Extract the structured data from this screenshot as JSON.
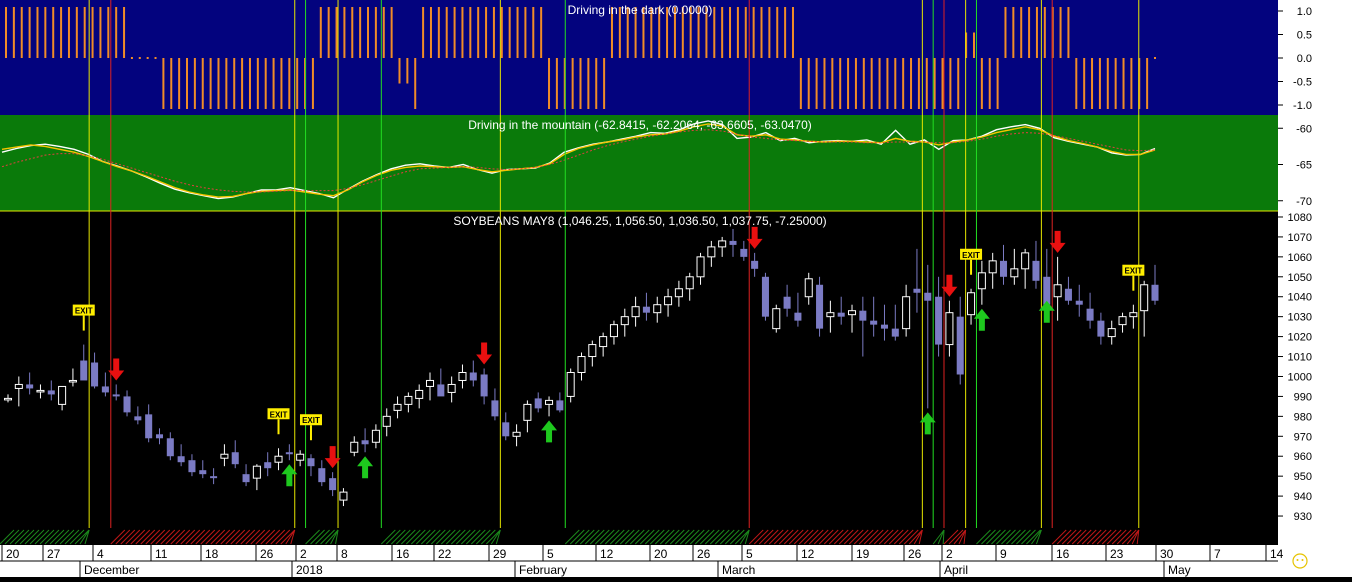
{
  "colors": {
    "panel1_bg": "#03037e",
    "panel2_bg": "#0a7a0a",
    "panel3_bg": "#000000",
    "axis_bg": "#ffffff",
    "bar_orange": "#f08c28",
    "fast_line": "#ffffff",
    "slow_line": "#f5c400",
    "trend_line": "#e04040",
    "candle_up": "#ffffff",
    "candle_down": "#7b7bc4",
    "buy_arrow": "#1ec81e",
    "sell_arrow": "#e81010",
    "exit_flag": "#ffee00",
    "vline_green": "#22dd22",
    "vline_red": "#dd2222",
    "vline_yellow": "#e6e600"
  },
  "chart_data": [
    {
      "type": "bar",
      "title": "Driving in the dark (0.0000)",
      "ylim": [
        -1.2,
        1.2
      ],
      "yticks": [
        "1.0",
        "0.5",
        "0.0",
        "-0.5",
        "-1.0"
      ],
      "ytick_values": [
        1.0,
        0.5,
        0.0,
        -0.5,
        -1.0
      ],
      "values": [
        1,
        1,
        1,
        1,
        1,
        1,
        1,
        1,
        1,
        1,
        1,
        1,
        1,
        1,
        1,
        1,
        0,
        0,
        0,
        0,
        -1,
        -1,
        -1,
        -1,
        -1,
        -1,
        -1,
        -1,
        -1,
        -1,
        -1,
        -1,
        -1,
        -1,
        -1,
        -1,
        -1,
        -1,
        -1,
        -1,
        1,
        1,
        1,
        1,
        1,
        1,
        1,
        1,
        1,
        1,
        -0.5,
        -0.5,
        -1,
        1,
        1,
        1,
        1,
        1,
        1,
        1,
        1,
        1,
        1,
        1,
        1,
        1,
        1,
        1,
        1,
        -1,
        -1,
        -1,
        -1,
        -1,
        -1,
        -1,
        -1,
        1,
        1,
        1,
        1,
        1,
        1,
        1,
        1,
        1,
        1,
        1,
        1,
        1,
        1,
        1,
        1,
        1,
        1,
        1,
        1,
        1,
        1,
        1,
        1,
        -1,
        -1,
        -1,
        -1,
        -1,
        -1,
        -1,
        -1,
        -1,
        -1,
        -1,
        -1,
        -1,
        -1,
        -1,
        -1,
        -1,
        -1,
        -1,
        -1,
        -1,
        0.5,
        0.5,
        -1,
        -1,
        -1,
        1,
        1,
        1,
        1,
        1,
        1,
        1,
        1,
        1,
        -1,
        -1,
        -1,
        -1,
        -1,
        -1,
        -1,
        -1,
        -1,
        -1,
        0
      ]
    },
    {
      "type": "line",
      "title": "Driving in the mountain (-62.8415, -62.2064, -63.6605, -63.0470)",
      "ylim": [
        -71,
        -59
      ],
      "yticks": [
        "-60",
        "-65",
        "-70"
      ],
      "ytick_values": [
        -60,
        -65,
        -70
      ],
      "series": [
        {
          "values": [
            -63.3,
            -62.8,
            -62.4,
            -62.2,
            -62.5,
            -62.9,
            -63.6,
            -64.6,
            -65.2,
            -65.9,
            -66.7,
            -67.6,
            -68.4,
            -68.9,
            -69.3,
            -69.7,
            -69.5,
            -69.0,
            -68.5,
            -68.5,
            -68.2,
            -68.6,
            -69.0,
            -69.6,
            -68.4,
            -67.3,
            -66.4,
            -65.6,
            -65.1,
            -64.9,
            -65.2,
            -65.4,
            -65.0,
            -65.7,
            -66.2,
            -65.7,
            -65.6,
            -65.5,
            -64.8,
            -63.3,
            -62.7,
            -62.2,
            -61.9,
            -61.5,
            -61.1,
            -60.6,
            -60.7,
            -60.2,
            -59.4,
            -59.0,
            -59.5,
            -61.4,
            -61.2,
            -60.6,
            -61.7,
            -61.4,
            -62.0,
            -61.8,
            -61.7,
            -61.8,
            -61.6,
            -62.2,
            -60.3,
            -62.2,
            -61.6,
            -62.9,
            -61.7,
            -61.6,
            -61.1,
            -60.2,
            -59.8,
            -59.5,
            -60.0,
            -61.3,
            -61.8,
            -62.2,
            -62.6,
            -63.4,
            -63.7,
            -63.6,
            -62.8
          ]
        },
        {
          "values": [
            -62.9,
            -62.6,
            -62.3,
            -62.5,
            -62.9,
            -63.3,
            -63.9,
            -64.6,
            -65.3,
            -65.9,
            -66.6,
            -67.4,
            -68.2,
            -68.8,
            -69.2,
            -69.5,
            -69.4,
            -69.0,
            -68.7,
            -68.6,
            -68.5,
            -68.8,
            -69.1,
            -69.3,
            -68.5,
            -67.4,
            -66.5,
            -65.8,
            -65.4,
            -65.2,
            -65.3,
            -65.4,
            -65.3,
            -65.7,
            -66.0,
            -65.8,
            -65.6,
            -65.4,
            -64.9,
            -63.6,
            -62.8,
            -62.3,
            -61.9,
            -61.6,
            -61.2,
            -60.9,
            -60.8,
            -60.4,
            -59.8,
            -59.4,
            -59.7,
            -60.9,
            -61.1,
            -60.9,
            -61.5,
            -61.6,
            -61.8,
            -61.9,
            -61.8,
            -61.8,
            -61.9,
            -62.0,
            -61.4,
            -61.8,
            -61.9,
            -62.3,
            -61.9,
            -61.6,
            -61.2,
            -60.6,
            -60.2,
            -59.8,
            -60.2,
            -61.1,
            -61.7,
            -62.1,
            -62.6,
            -63.2,
            -63.6,
            -63.6,
            -63.0
          ]
        },
        {
          "values": [
            -65.3,
            -64.7,
            -64.2,
            -63.7,
            -63.5,
            -63.5,
            -63.8,
            -64.3,
            -64.9,
            -65.5,
            -66.1,
            -66.7,
            -67.3,
            -67.8,
            -68.2,
            -68.5,
            -68.7,
            -68.8,
            -68.8,
            -68.7,
            -68.6,
            -68.6,
            -68.6,
            -68.6,
            -68.3,
            -67.8,
            -67.2,
            -66.6,
            -66.0,
            -65.6,
            -65.5,
            -65.4,
            -65.3,
            -65.4,
            -65.6,
            -65.7,
            -65.6,
            -65.4,
            -65.0,
            -64.4,
            -63.7,
            -63.0,
            -62.4,
            -61.9,
            -61.5,
            -61.1,
            -60.8,
            -60.5,
            -60.3,
            -60.2,
            -60.4,
            -60.8,
            -61.2,
            -61.4,
            -61.6,
            -61.7,
            -61.8,
            -61.9,
            -61.9,
            -61.9,
            -62.0,
            -62.0,
            -61.9,
            -61.9,
            -61.9,
            -62.0,
            -62.0,
            -61.8,
            -61.5,
            -61.1,
            -60.8,
            -60.6,
            -60.7,
            -61.0,
            -61.4,
            -61.8,
            -62.2,
            -62.6,
            -63.0,
            -63.1,
            -63.0
          ]
        }
      ]
    },
    {
      "type": "candlestick",
      "title": "SOYBEANS MAY8 (1,046.25, 1,056.50, 1,036.50, 1,037.75, -7.25000)",
      "ylim": [
        924,
        1083
      ],
      "yticks": [
        "1080",
        "1070",
        "1060",
        "1050",
        "1040",
        "1030",
        "1020",
        "1010",
        "1000",
        "990",
        "980",
        "970",
        "960",
        "950",
        "940",
        "930"
      ],
      "ytick_values": [
        1080,
        1070,
        1060,
        1050,
        1040,
        1030,
        1020,
        1010,
        1000,
        990,
        980,
        970,
        960,
        950,
        940,
        930
      ],
      "ohlc": [
        [
          989,
          991,
          987,
          989
        ],
        [
          994,
          1000,
          985,
          996
        ],
        [
          996,
          1002,
          991,
          994
        ],
        [
          993,
          996,
          989,
          993
        ],
        [
          993,
          998,
          988,
          991
        ],
        [
          986,
          994,
          983,
          995
        ],
        [
          998,
          1004,
          995,
          998
        ],
        [
          1008,
          1016,
          1003,
          998
        ],
        [
          1007,
          1012,
          994,
          995
        ],
        [
          995,
          1002,
          990,
          992
        ],
        [
          991,
          996,
          988,
          990
        ],
        [
          990,
          993,
          980,
          982
        ],
        [
          980,
          985,
          976,
          978
        ],
        [
          981,
          986,
          967,
          969
        ],
        [
          971,
          974,
          966,
          969
        ],
        [
          969,
          972,
          958,
          960
        ],
        [
          960,
          966,
          955,
          957
        ],
        [
          958,
          961,
          950,
          952
        ],
        [
          953,
          958,
          949,
          951
        ],
        [
          950,
          954,
          946,
          949
        ],
        [
          959,
          966,
          955,
          961
        ],
        [
          962,
          968,
          954,
          956
        ],
        [
          951,
          956,
          945,
          947
        ],
        [
          949,
          956,
          943,
          955
        ],
        [
          957,
          962,
          950,
          954
        ],
        [
          957,
          964,
          953,
          960
        ],
        [
          962,
          966,
          958,
          961
        ],
        [
          958,
          963,
          955,
          961
        ],
        [
          959,
          961,
          950,
          955
        ],
        [
          954,
          958,
          945,
          947
        ],
        [
          949,
          952,
          940,
          943
        ],
        [
          938,
          944,
          935,
          942
        ],
        [
          962,
          970,
          960,
          967
        ],
        [
          968,
          974,
          962,
          966
        ],
        [
          967,
          976,
          964,
          973
        ],
        [
          975,
          984,
          970,
          980
        ],
        [
          983,
          990,
          979,
          986
        ],
        [
          986,
          992,
          982,
          990
        ],
        [
          989,
          996,
          984,
          993
        ],
        [
          995,
          1002,
          988,
          998
        ],
        [
          996,
          1004,
          991,
          990
        ],
        [
          992,
          1000,
          987,
          996
        ],
        [
          998,
          1006,
          994,
          1002
        ],
        [
          1002,
          1008,
          995,
          998
        ],
        [
          1001,
          1004,
          986,
          990
        ],
        [
          988,
          994,
          978,
          980
        ],
        [
          977,
          982,
          968,
          970
        ],
        [
          970,
          976,
          965,
          972
        ],
        [
          978,
          988,
          972,
          986
        ],
        [
          989,
          992,
          982,
          984
        ],
        [
          986,
          990,
          980,
          988
        ],
        [
          988,
          992,
          982,
          983
        ],
        [
          990,
          1004,
          987,
          1002
        ],
        [
          1002,
          1012,
          998,
          1010
        ],
        [
          1010,
          1018,
          1005,
          1016
        ],
        [
          1015,
          1022,
          1010,
          1020
        ],
        [
          1020,
          1028,
          1016,
          1026
        ],
        [
          1026,
          1034,
          1020,
          1030
        ],
        [
          1030,
          1040,
          1025,
          1035
        ],
        [
          1035,
          1042,
          1028,
          1032
        ],
        [
          1032,
          1040,
          1027,
          1036
        ],
        [
          1036,
          1044,
          1030,
          1040
        ],
        [
          1040,
          1048,
          1035,
          1044
        ],
        [
          1044,
          1052,
          1038,
          1050
        ],
        [
          1050,
          1062,
          1046,
          1060
        ],
        [
          1060,
          1068,
          1055,
          1065
        ],
        [
          1065,
          1070,
          1060,
          1068
        ],
        [
          1068,
          1074,
          1060,
          1066
        ],
        [
          1064,
          1068,
          1058,
          1060
        ],
        [
          1058,
          1062,
          1050,
          1054
        ],
        [
          1050,
          1052,
          1028,
          1030
        ],
        [
          1024,
          1036,
          1022,
          1034
        ],
        [
          1040,
          1046,
          1030,
          1034
        ],
        [
          1032,
          1042,
          1025,
          1028
        ],
        [
          1040,
          1052,
          1036,
          1049
        ],
        [
          1046,
          1050,
          1020,
          1024
        ],
        [
          1030,
          1038,
          1022,
          1032
        ],
        [
          1032,
          1040,
          1026,
          1030
        ],
        [
          1031,
          1036,
          1022,
          1033
        ],
        [
          1033,
          1040,
          1010,
          1028
        ],
        [
          1028,
          1040,
          1020,
          1026
        ],
        [
          1026,
          1036,
          1018,
          1024
        ],
        [
          1024,
          1036,
          1018,
          1020
        ],
        [
          1024,
          1046,
          1020,
          1040
        ],
        [
          1044,
          1064,
          1032,
          1042
        ],
        [
          1042,
          1056,
          984,
          1038
        ],
        [
          1040,
          1050,
          1010,
          1016
        ],
        [
          1016,
          1038,
          1010,
          1032
        ],
        [
          1030,
          1040,
          996,
          1001
        ],
        [
          1031,
          1044,
          1026,
          1042
        ],
        [
          1044,
          1058,
          1036,
          1052
        ],
        [
          1052,
          1062,
          1044,
          1058
        ],
        [
          1058,
          1066,
          1046,
          1050
        ],
        [
          1050,
          1064,
          1046,
          1054
        ],
        [
          1054,
          1064,
          1044,
          1062
        ],
        [
          1058,
          1068,
          1044,
          1048
        ],
        [
          1050,
          1064,
          1040,
          1036
        ],
        [
          1040,
          1060,
          1028,
          1046
        ],
        [
          1044,
          1050,
          1036,
          1038
        ],
        [
          1038,
          1046,
          1030,
          1036
        ],
        [
          1034,
          1042,
          1024,
          1028
        ],
        [
          1028,
          1032,
          1016,
          1020
        ],
        [
          1020,
          1028,
          1016,
          1024
        ],
        [
          1026,
          1032,
          1022,
          1030
        ],
        [
          1030,
          1036,
          1024,
          1032
        ],
        [
          1033,
          1048,
          1020,
          1046
        ],
        [
          1046,
          1056,
          1036,
          1038
        ]
      ],
      "signals": [
        {
          "kind": "exit",
          "label": "EXIT",
          "at": 7
        },
        {
          "kind": "sell",
          "at": 10
        },
        {
          "kind": "buy",
          "at": 26
        },
        {
          "kind": "exit",
          "label": "EXIT",
          "at": 25
        },
        {
          "kind": "exit",
          "label": "EXIT",
          "at": 28
        },
        {
          "kind": "sell",
          "at": 30
        },
        {
          "kind": "buy",
          "at": 33
        },
        {
          "kind": "sell",
          "at": 44
        },
        {
          "kind": "buy",
          "at": 50
        },
        {
          "kind": "sell",
          "at": 69
        },
        {
          "kind": "buy",
          "at": 85
        },
        {
          "kind": "sell",
          "at": 87
        },
        {
          "kind": "exit",
          "label": "EXIT",
          "at": 89
        },
        {
          "kind": "buy",
          "at": 90
        },
        {
          "kind": "buy",
          "at": 96
        },
        {
          "kind": "sell",
          "at": 97
        },
        {
          "kind": "exit",
          "label": "EXIT",
          "at": 104
        }
      ]
    }
  ],
  "vertical_lines": [
    {
      "at": 7,
      "color": "yellow"
    },
    {
      "at": 9,
      "color": "red"
    },
    {
      "at": 26,
      "color": "yellow"
    },
    {
      "at": 27,
      "color": "green"
    },
    {
      "at": 30,
      "color": "yellow"
    },
    {
      "at": 34,
      "color": "green"
    },
    {
      "at": 45,
      "color": "yellow"
    },
    {
      "at": 51,
      "color": "green"
    },
    {
      "at": 68,
      "color": "red"
    },
    {
      "at": 84,
      "color": "yellow"
    },
    {
      "at": 85,
      "color": "green"
    },
    {
      "at": 86,
      "color": "red"
    },
    {
      "at": 88,
      "color": "yellow"
    },
    {
      "at": 89,
      "color": "green"
    },
    {
      "at": 95,
      "color": "yellow"
    },
    {
      "at": 96,
      "color": "red"
    },
    {
      "at": 104,
      "color": "yellow"
    }
  ],
  "x_axis": {
    "day_labels": [
      "20",
      "27",
      "4",
      "11",
      "18",
      "26",
      "2",
      "8",
      "16",
      "22",
      "29",
      "5",
      "12",
      "20",
      "26",
      "5",
      "12",
      "19",
      "26",
      "2",
      "9",
      "16",
      "23",
      "30",
      "7",
      "14"
    ],
    "month_labels": [
      "December",
      "2018",
      "February",
      "March",
      "April",
      "May"
    ]
  }
}
